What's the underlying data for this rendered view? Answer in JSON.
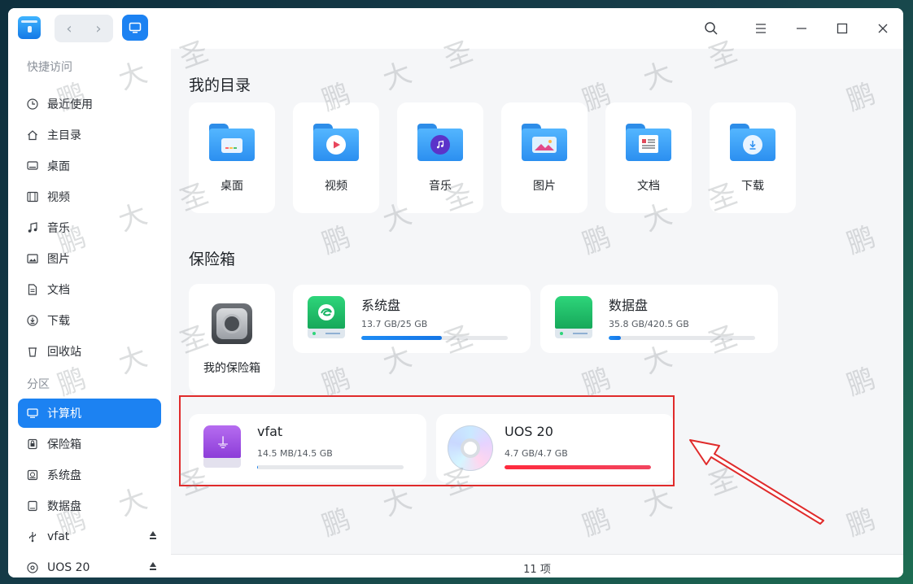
{
  "title_bar": {
    "nav_back": "‹",
    "nav_forward": "›",
    "icons": [
      "file-manager-app-icon",
      "back-arrow-icon",
      "forward-arrow-icon",
      "computer-view-icon",
      "search-icon",
      "menu-icon",
      "minimize-icon",
      "maximize-icon",
      "close-icon"
    ]
  },
  "sidebar": {
    "sections": {
      "quick_access": "快捷访问",
      "partitions": "分区"
    },
    "quick_items": [
      {
        "label": "最近使用",
        "icon": "clock-icon"
      },
      {
        "label": "主目录",
        "icon": "home-icon"
      },
      {
        "label": "桌面",
        "icon": "desktop-icon"
      },
      {
        "label": "视频",
        "icon": "video-icon"
      },
      {
        "label": "音乐",
        "icon": "music-icon"
      },
      {
        "label": "图片",
        "icon": "picture-icon"
      },
      {
        "label": "文档",
        "icon": "document-icon"
      },
      {
        "label": "下载",
        "icon": "download-icon"
      },
      {
        "label": "回收站",
        "icon": "trash-icon"
      }
    ],
    "partition_items": [
      {
        "label": "计算机",
        "icon": "computer-icon",
        "active": true
      },
      {
        "label": "保险箱",
        "icon": "vault-icon"
      },
      {
        "label": "系统盘",
        "icon": "system-disk-icon"
      },
      {
        "label": "数据盘",
        "icon": "data-disk-icon"
      },
      {
        "label": "vfat",
        "icon": "usb-icon",
        "eject": true
      },
      {
        "label": "UOS 20",
        "icon": "disc-icon",
        "eject": true
      }
    ]
  },
  "main": {
    "my_directories_title": "我的目录",
    "directories": [
      {
        "label": "桌面",
        "icon": "desktop-folder-icon"
      },
      {
        "label": "视频",
        "icon": "video-folder-icon"
      },
      {
        "label": "音乐",
        "icon": "music-folder-icon"
      },
      {
        "label": "图片",
        "icon": "picture-folder-icon"
      },
      {
        "label": "文档",
        "icon": "document-folder-icon"
      },
      {
        "label": "下载",
        "icon": "download-folder-icon"
      }
    ],
    "vault_title": "保险箱",
    "vault_card_label": "我的保险箱",
    "disks": [
      {
        "name": "系统盘",
        "usage": "13.7 GB/25 GB",
        "used_fraction": 0.548
      },
      {
        "name": "数据盘",
        "usage": "35.8 GB/420.5 GB",
        "used_fraction": 0.085
      }
    ],
    "external": [
      {
        "name": "vfat",
        "usage": "14.5 MB/14.5 GB",
        "used_fraction": 0.001
      },
      {
        "name": "UOS 20",
        "usage": "4.7 GB/4.7 GB",
        "used_fraction": 1.0
      }
    ]
  },
  "status_bar": {
    "count_text": "11 项"
  },
  "watermark": {
    "chars": [
      "圣",
      "大",
      "鹏"
    ]
  },
  "colors": {
    "accent": "#1c82f2",
    "highlight": "#e02b2b",
    "full_disk": "#ff2a3d"
  }
}
